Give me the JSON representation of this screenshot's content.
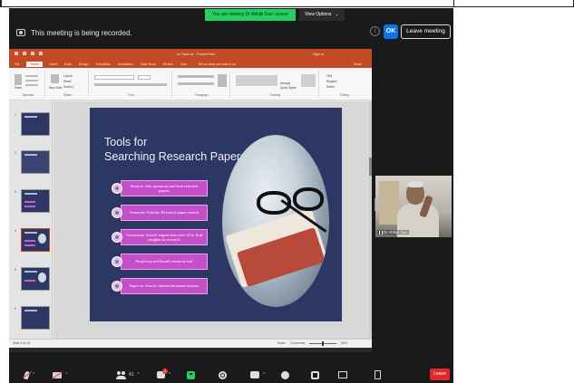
{
  "banner": {
    "viewing_text": "You are viewing Dr Abhijit Das' screen",
    "view_options_label": "View Options",
    "view_options_caret": "⌄"
  },
  "meeting": {
    "recording_text": "This meeting is being recorded.",
    "info_glyph": "i",
    "ok_label": "OK",
    "leave_meeting_label": "Leave meeting"
  },
  "powerpoint": {
    "file_title": "AI Tools.ai - PowerPoint",
    "user_name": "Sign in",
    "tabs": [
      "File",
      "Home",
      "Insert",
      "Draw",
      "Design",
      "Transitions",
      "Animations",
      "Slide Show",
      "Review",
      "View"
    ],
    "active_tab_index": 1,
    "tell_me": "Tell me what you want to do",
    "share_label": "Share",
    "ribbon_groups": [
      "Clipboard",
      "Slides",
      "Font",
      "Paragraph",
      "Drawing",
      "Editing"
    ],
    "ribbon_buttons": {
      "paste": "Paste",
      "new_slide": "New Slide",
      "layout": "Layout",
      "reset": "Reset",
      "section": "Section",
      "arrange": "Arrange",
      "quick_styles": "Quick Styles",
      "find": "Find",
      "replace": "Replace",
      "select": "Select"
    },
    "slide_numbers": [
      "1",
      "2",
      "3",
      "4",
      "5",
      "6"
    ],
    "status_left": "Slide 4 of 10",
    "status_notes": "Notes",
    "status_comments": "Comments",
    "status_zoom": "90%"
  },
  "slide": {
    "title_line1": "Tools for",
    "title_line2": "Searching  Research Papers",
    "tools": [
      "Jenni.ai: Ask questions and find research papers",
      "Semantic Scholar: Research paper search",
      "Consensus: Search engine that uses AI to find insights in research",
      "Perplexity.ai:Overall research tool",
      "Sapro.ai: Search citation/inclusion feature"
    ]
  },
  "participant": {
    "name": "Dr Abhijit Das"
  },
  "toolbar": {
    "caret": "^",
    "participants_count": "41",
    "chat_badge": "1",
    "leave_label": "Leave"
  },
  "colors": {
    "zoom_bg": "#1a1a1a",
    "share_banner": "#23d160",
    "ok_blue": "#0e72ed",
    "leave_red": "#e02828",
    "ppt_accent": "#c24a24",
    "slide_bg": "#2c3763",
    "tool_pink": "#c44fc9"
  }
}
